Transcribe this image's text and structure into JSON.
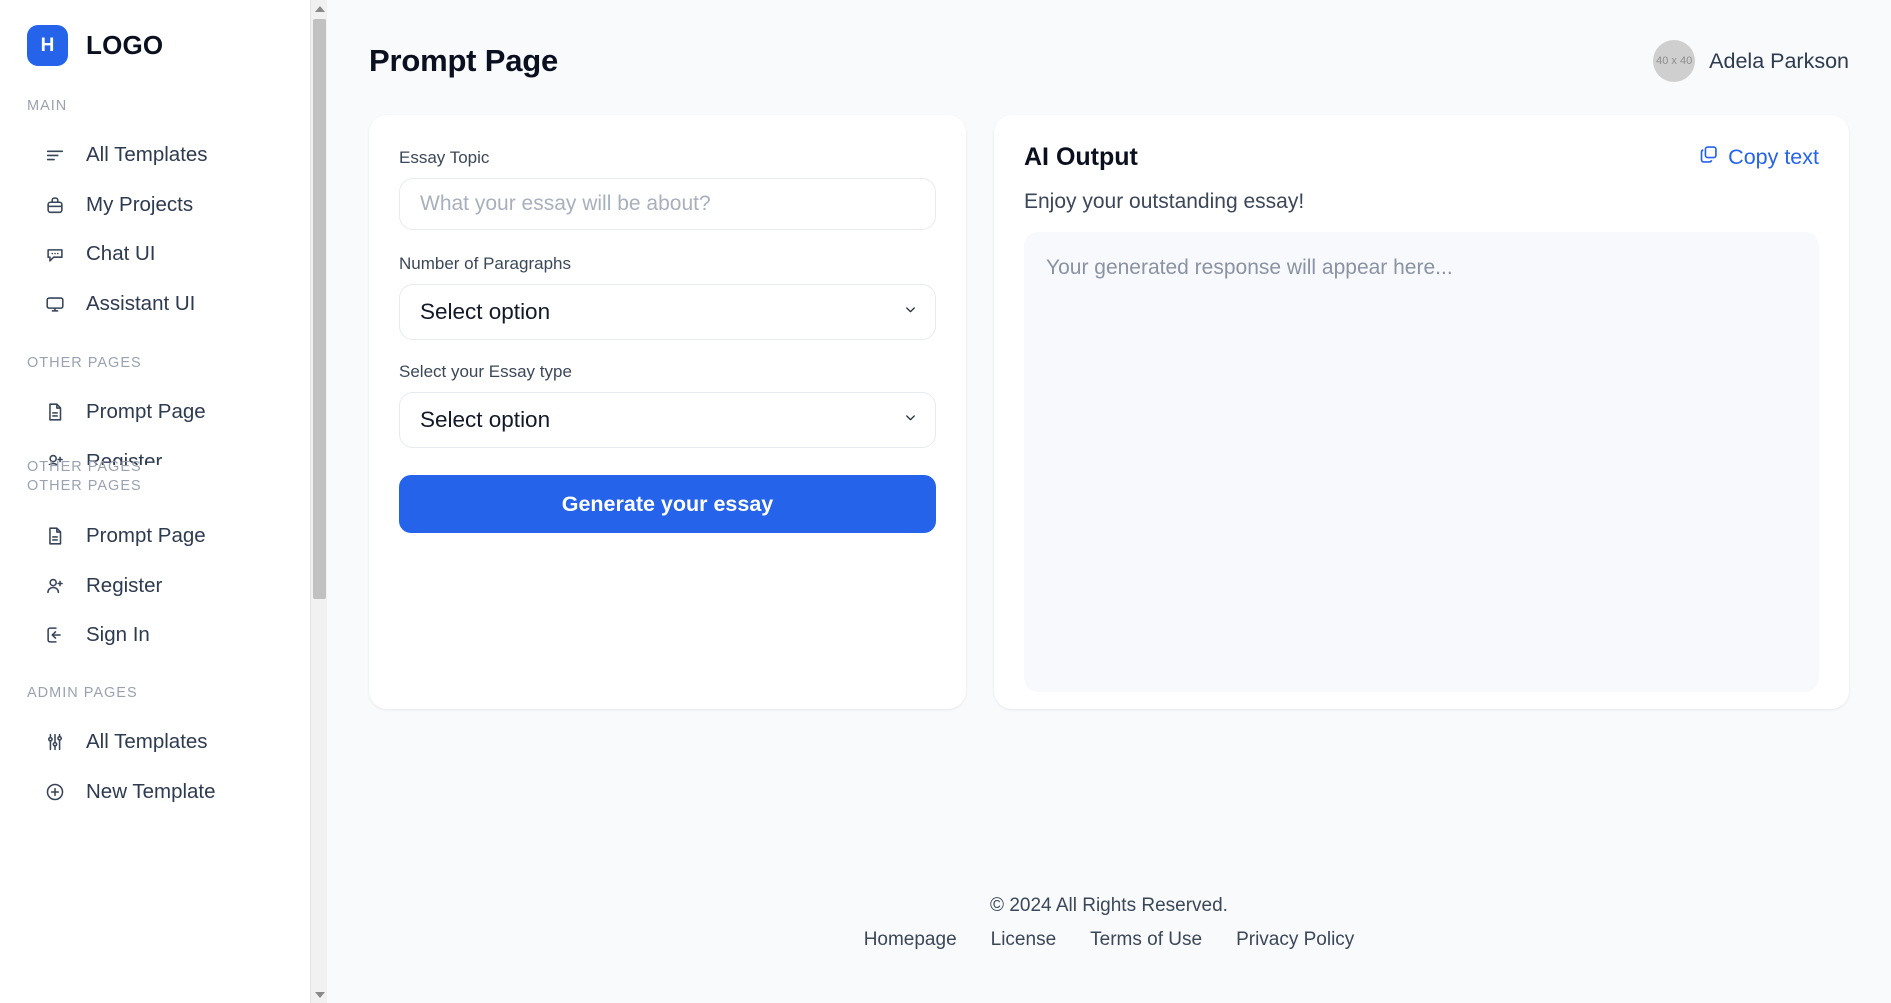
{
  "brand": {
    "badge_letter": "H",
    "name": "LOGO"
  },
  "sidebar": {
    "sections": [
      {
        "caption": "MAIN",
        "items": [
          {
            "label": "All Templates",
            "icon": "list-icon"
          },
          {
            "label": "My Projects",
            "icon": "briefcase-icon"
          },
          {
            "label": "Chat UI",
            "icon": "chat-bubble-icon"
          },
          {
            "label": "Assistant UI",
            "icon": "monitor-icon"
          }
        ]
      },
      {
        "caption": "OTHER PAGES",
        "items": [
          {
            "label": "Prompt Page",
            "icon": "document-icon"
          },
          {
            "label": "Register",
            "icon": "user-plus-icon"
          }
        ]
      },
      {
        "caption": "OTHER PAGES",
        "items": []
      },
      {
        "caption": "OTHER PAGES",
        "items": [
          {
            "label": "Prompt Page",
            "icon": "document-icon"
          },
          {
            "label": "Register",
            "icon": "user-plus-icon"
          },
          {
            "label": "Sign In",
            "icon": "sign-in-icon"
          }
        ]
      },
      {
        "caption": "ADMIN PAGES",
        "items": [
          {
            "label": "All Templates",
            "icon": "sliders-icon"
          },
          {
            "label": "New Template",
            "icon": "plus-circle-icon"
          }
        ]
      }
    ]
  },
  "header": {
    "title": "Prompt Page",
    "user": {
      "name": "Adela Parkson",
      "avatar_placeholder": "40 x 40"
    }
  },
  "form": {
    "topic_label": "Essay Topic",
    "topic_value": "",
    "topic_placeholder": "What your essay will be about?",
    "paragraphs_label": "Number of Paragraphs",
    "paragraphs_selected": "Select option",
    "essay_type_label": "Select your Essay type",
    "essay_type_selected": "Select option",
    "submit_label": "Generate your essay"
  },
  "output": {
    "title": "AI Output",
    "copy_label": "Copy text",
    "subtitle": "Enjoy your outstanding essay!",
    "placeholder": "Your generated response will appear here..."
  },
  "footer": {
    "copyright": "© 2024 All Rights Reserved.",
    "links": [
      "Homepage",
      "License",
      "Terms of Use",
      "Privacy Policy"
    ]
  },
  "colors": {
    "accent": "#2563EB",
    "page_bg": "#f8fafc",
    "text": "#2d3a4f"
  }
}
